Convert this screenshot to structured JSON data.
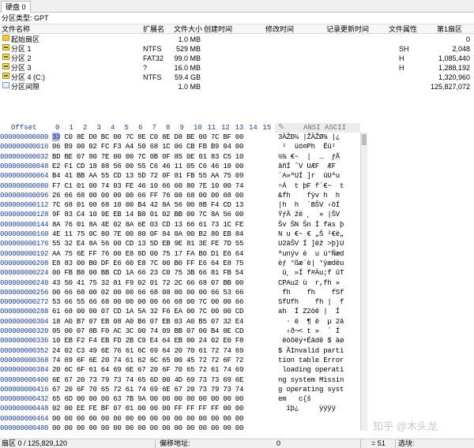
{
  "tabs": [
    {
      "label": "硬盘 0"
    }
  ],
  "info": {
    "partition_type": "分区类型: GPT"
  },
  "partition_table": {
    "columns": [
      "文件名称",
      "扩展名",
      "文件大小",
      "创建时间",
      "修改时间",
      "记录更新时间",
      "文件属性",
      "第1扇区"
    ],
    "rows": [
      {
        "name": "起始扇区",
        "ext": "",
        "size": "1.0 MB",
        "attr": "",
        "first_sector": "0",
        "icon": "folder"
      },
      {
        "name": "分区 1",
        "ext": "NTFS",
        "size": "529 MB",
        "attr": "SH",
        "first_sector": "2,048",
        "icon": "part"
      },
      {
        "name": "分区 2",
        "ext": "FAT32",
        "size": "99.0 MB",
        "attr": "H",
        "first_sector": "1,085,440",
        "icon": "part"
      },
      {
        "name": "分区 3",
        "ext": "?",
        "size": "16.0 MB",
        "attr": "H",
        "first_sector": "1,288,192",
        "icon": "part"
      },
      {
        "name": "分区 4 (C:)",
        "ext": "NTFS",
        "size": "59.4 GB",
        "attr": "",
        "first_sector": "1,320,960",
        "icon": "part"
      },
      {
        "name": "分区间隙",
        "ext": "",
        "size": "1.0 MB",
        "attr": "",
        "first_sector": "125,827,072",
        "icon": "gap"
      }
    ]
  },
  "hex_header": {
    "offset": "Offset",
    "columns": [
      "0",
      "1",
      "2",
      "3",
      "4",
      "5",
      "6",
      "7",
      "8",
      "9",
      "10",
      "11",
      "12",
      "13",
      "14",
      "15"
    ],
    "ascii_label": "ANSI ASCII"
  },
  "hex_rows": [
    {
      "o": "000000000000",
      "h": "33 C0 8E D0 BC 00 7C 8E C0 8E D8 BE 00 7C BF 00",
      "a": "3ÀŽÐ¼ |ŽÀŽØ¾ |¿"
    },
    {
      "o": "000000000016",
      "h": "06 B9 00 02 FC F3 A4 50 68 1C 06 CB FB B9 04 00",
      "a": " ¹  üó¤Ph  Ëû¹"
    },
    {
      "o": "000000000032",
      "h": "BD BE 07 80 7E 00 00 7C 0B 0F 85 0E 01 83 C5 10",
      "a": "½¾ €~  |  …  ƒÅ"
    },
    {
      "o": "000000000048",
      "h": "E2 F1 CD 18 88 56 00 55 C6 46 11 05 C6 46 10 00",
      "a": "âñÍ ˆV UÆF  ÆF"
    },
    {
      "o": "000000000064",
      "h": "B4 41 BB AA 55 CD 13 5D 72 0F 81 FB 55 AA 75 09",
      "a": "´A»ªUÍ ]r  ûUªu"
    },
    {
      "o": "000000000080",
      "h": "F7 C1 01 00 74 03 FE 46 10 66 60 80 7E 10 00 74",
      "a": "÷Á  t þF f`€~  t"
    },
    {
      "o": "000000000096",
      "h": "26 66 68 00 00 00 00 66 FF 76 08 68 00 00 68 00",
      "a": "&fh    fÿv h  h"
    },
    {
      "o": "000000000112",
      "h": "7C 68 01 00 68 10 00 B4 42 8A 56 00 8B F4 CD 13",
      "a": "|h  h  ´BŠV ‹ôÍ"
    },
    {
      "o": "000000000128",
      "h": "9F 83 C4 10 9E EB 14 B8 01 02 BB 00 7C 8A 56 00",
      "a": "ŸƒÄ žë ¸  » |ŠV"
    },
    {
      "o": "000000000144",
      "h": "8A 76 01 8A 4E 02 8A 6E 03 CD 13 66 61 73 1C FE",
      "a": "Šv ŠN Šn Í fas þ"
    },
    {
      "o": "000000000160",
      "h": "4E 11 75 0C 80 7E 00 80 0F 84 8A 00 B2 80 EB 84",
      "a": "N u €~ € „Š ²€ë„"
    },
    {
      "o": "000000000176",
      "h": "55 32 E4 8A 56 00 CD 13 5D EB 9E 81 3E FE 7D 55",
      "a": "U2äŠV Í ]ëž >þ}U"
    },
    {
      "o": "000000000192",
      "h": "AA 75 6E FF 76 00 E8 8D 00 75 17 FA B0 D1 E6 64",
      "a": "ªunÿv è  u ú°Ñæd"
    },
    {
      "o": "000000000208",
      "h": "E8 83 00 B0 DF E6 60 E8 7C 00 B0 FF E6 64 E8 75",
      "a": "èƒ °ßæ`è| °ÿædèu"
    },
    {
      "o": "000000000224",
      "h": "00 FB B8 00 BB CD 1A 66 23 C0 75 3B 66 81 FB 54",
      "a": " û¸ »Í f#Àu;f ûT"
    },
    {
      "o": "000000000240",
      "h": "43 50 41 75 32 81 F9 02 01 72 2C 66 68 07 BB 00",
      "a": "CPAu2 ù  r,fh »"
    },
    {
      "o": "000000000256",
      "h": "00 66 68 00 02 00 00 66 68 08 00 00 00 66 53 66",
      "a": " fh    fh    fSf"
    },
    {
      "o": "000000000272",
      "h": "53 66 55 66 68 00 00 00 00 66 68 00 7C 00 00 66",
      "a": "SfUfh    fh |  f"
    },
    {
      "o": "000000000288",
      "h": "61 68 00 00 07 CD 1A 5A 32 F6 EA 00 7C 00 00 CD",
      "a": "ah  Í Z2öê |  Í"
    },
    {
      "o": "000000000304",
      "h": "18 A0 B7 07 EB 08 A0 B6 07 EB 03 A0 B5 07 32 E4",
      "a": "  · ë  ¶ ë  µ 2ä"
    },
    {
      "o": "000000000320",
      "h": "05 00 07 8B F0 AC 3C 00 74 09 BB 07 00 B4 0E CD",
      "a": "  ‹ð¬< t »  ´ Í"
    },
    {
      "o": "000000000336",
      "h": "10 EB F2 F4 EB FD 2B C9 E4 64 EB 00 24 02 E0 F8",
      "a": " ëòôëý+Éädë $ àø"
    },
    {
      "o": "000000000352",
      "h": "24 02 C3 49 6E 76 61 6C 69 64 20 70 61 72 74 69",
      "a": "$ ÃInvalid parti"
    },
    {
      "o": "000000000368",
      "h": "74 69 6F 6E 20 74 61 62 6C 65 00 45 72 72 6F 72",
      "a": "tion table Error"
    },
    {
      "o": "000000000384",
      "h": "20 6C 6F 61 64 69 6E 67 20 6F 70 65 72 61 74 69",
      "a": " loading operati"
    },
    {
      "o": "000000000400",
      "h": "6E 67 20 73 79 73 74 65 6D 00 4D 69 73 73 69 6E",
      "a": "ng system Missin"
    },
    {
      "o": "000000000416",
      "h": "67 20 6F 70 65 72 61 74 69 6E 67 20 73 79 73 74",
      "a": "g operating syst"
    },
    {
      "o": "000000000432",
      "h": "65 6D 00 00 00 63 7B 9A 00 00 00 00 00 00 00 00",
      "a": "em   c{š"
    },
    {
      "o": "000000000448",
      "h": "02 00 EE FE BF 07 01 00 00 00 FF FF FF FF 00 00",
      "a": "  îþ¿     ÿÿÿÿ"
    },
    {
      "o": "000000000464",
      "h": "00 00 00 00 00 00 00 00 00 00 00 00 00 00 00 00",
      "a": ""
    },
    {
      "o": "000000000480",
      "h": "00 00 00 00 00 00 00 00 00 00 00 00 00 00 00 00",
      "a": ""
    }
  ],
  "status": {
    "sector": "扇区 0 / 125,829,120",
    "offset_label": "偏移地址:",
    "offset_value": "0",
    "value": "= 51",
    "selection_label": "选块:"
  },
  "watermark": "知乎 @木头龙"
}
